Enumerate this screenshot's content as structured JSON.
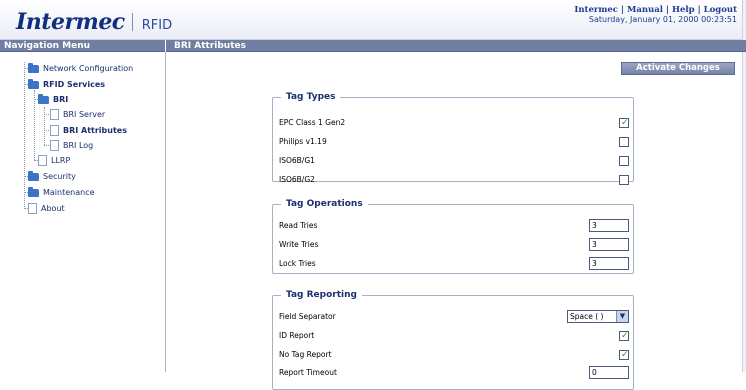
{
  "header": {
    "logo_text": "Intermec",
    "product": "RFID",
    "links": [
      "Intermec",
      "Manual",
      "Help",
      "Logout"
    ],
    "datetime": "Saturday, January 01, 2000 00:23:51"
  },
  "titlebar": {
    "nav_title": "Navigation Menu",
    "page_title": "BRI Attributes"
  },
  "nav": {
    "network_configuration": "Network Configuration",
    "rfid_services": "RFID Services",
    "bri": "BRI",
    "bri_server": "BRI Server",
    "bri_attributes": "BRI Attributes",
    "bri_log": "BRI Log",
    "llrp": "LLRP",
    "security": "Security",
    "maintenance": "Maintenance",
    "about": "About"
  },
  "actions": {
    "activate_label": "Activate Changes"
  },
  "tag_types": {
    "legend": "Tag Types",
    "items": [
      {
        "label": "EPC Class 1 Gen2",
        "checked": true
      },
      {
        "label": "Philips v1.19",
        "checked": false
      },
      {
        "label": "ISO6B/G1",
        "checked": false
      },
      {
        "label": "ISO6B/G2",
        "checked": false
      }
    ]
  },
  "tag_operations": {
    "legend": "Tag Operations",
    "read_label": "Read Tries",
    "read_value": "3",
    "write_label": "Write Tries",
    "write_value": "3",
    "lock_label": "Lock Tries",
    "lock_value": "3"
  },
  "tag_reporting": {
    "legend": "Tag Reporting",
    "field_separator_label": "Field Separator",
    "field_separator_value": "Space ( )",
    "id_report_label": "ID Report",
    "id_report_checked": true,
    "no_tag_report_label": "No Tag Report",
    "no_tag_report_checked": true,
    "report_timeout_label": "Report Timeout",
    "report_timeout_value": "0"
  },
  "colors": {
    "brand": "#102f7e",
    "titlebar": "#6f7ea1",
    "check": "#3a8a2a"
  }
}
